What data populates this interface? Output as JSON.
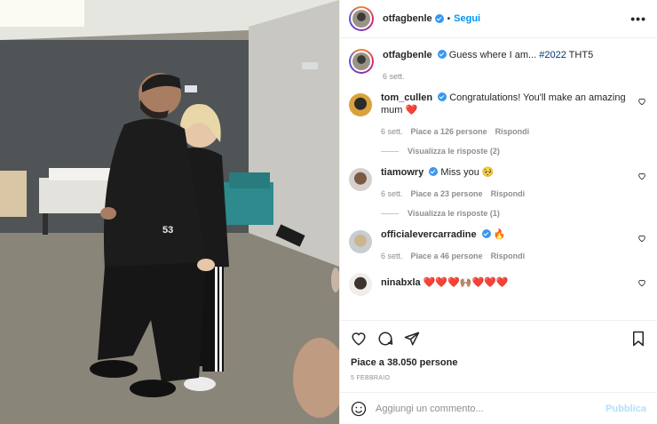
{
  "header": {
    "username": "otfagbenle",
    "separator": "•",
    "follow_label": "Segui",
    "more_label": "•••"
  },
  "caption": {
    "username": "otfagbenle",
    "text": "Guess where I am... ",
    "hashtag": "#2022",
    "text_after": " THT5",
    "time": "6 sett."
  },
  "comments": [
    {
      "username": "tom_cullen",
      "text": "Congratulations! You'll make an amazing mum ❤️",
      "time": "6 sett.",
      "likes": "Piace a 126 persone",
      "reply": "Rispondi",
      "view_replies": "Visualizza le risposte (2)"
    },
    {
      "username": "tiamowry",
      "text": "Miss you 🥺",
      "time": "6 sett.",
      "likes": "Piace a 23 persone",
      "reply": "Rispondi",
      "view_replies": "Visualizza le risposte (1)"
    },
    {
      "username": "officialevercarradine",
      "text": "🔥",
      "time": "6 sett.",
      "likes": "Piace a 46 persone",
      "reply": "Rispondi"
    },
    {
      "username": "ninabxla",
      "text": "❤️❤️❤️🙌🏽❤️❤️❤️"
    }
  ],
  "post": {
    "likes": "Piace a 38.050 persone",
    "date": "5 FEBBRAIO"
  },
  "comment_input": {
    "placeholder": "Aggiungi un commento...",
    "publish_label": "Pubblica"
  },
  "icons": {
    "like": "heart-icon",
    "comment": "comment-icon",
    "share": "share-icon",
    "save": "bookmark-icon",
    "emoji": "emoji-icon",
    "more": "more-icon",
    "verified": "verified-badge-icon"
  },
  "colors": {
    "link": "#0095f6",
    "hashtag": "#00376b",
    "verified": "#3897f0",
    "muted": "#8e8e8e",
    "publish_disabled": "#b2dffc"
  }
}
